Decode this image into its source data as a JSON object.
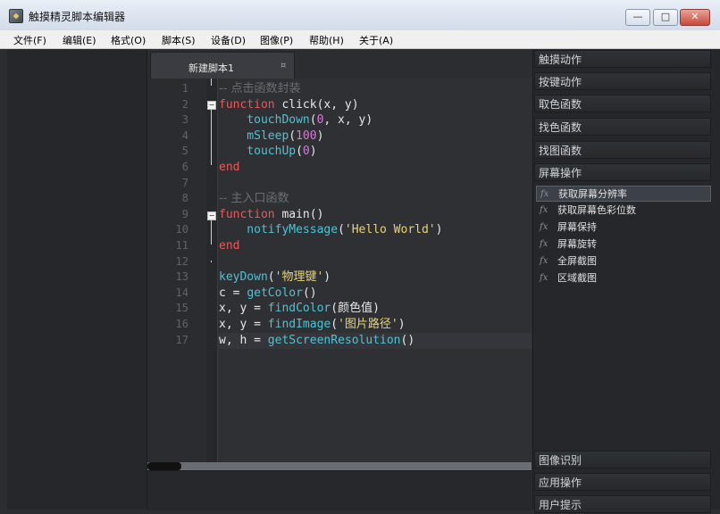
{
  "window": {
    "title": "触摸精灵脚本编辑器",
    "controls": {
      "minimize": "—",
      "maximize": "□",
      "close": "✕"
    }
  },
  "menu": [
    "文件(F)",
    "编辑(E)",
    "格式(O)",
    "脚本(S)",
    "设备(D)",
    "图像(P)",
    "帮助(H)",
    "关于(A)"
  ],
  "editor": {
    "tab": {
      "label": "新建脚本1",
      "close": "¤"
    },
    "line_numbers": [
      "1",
      "2",
      "3",
      "4",
      "5",
      "6",
      "7",
      "8",
      "9",
      "10",
      "11",
      "12",
      "13",
      "14",
      "15",
      "16",
      "17"
    ],
    "lines": [
      [
        {
          "t": "-- 点击函数封装",
          "c": "comment"
        }
      ],
      [
        {
          "t": "function",
          "c": "kw"
        },
        {
          "t": " click(x, y)",
          "c": "fn"
        }
      ],
      [
        {
          "t": "    touchDown",
          "c": "call"
        },
        {
          "t": "(",
          "c": "plain"
        },
        {
          "t": "0",
          "c": "num"
        },
        {
          "t": ", x, y)",
          "c": "plain"
        }
      ],
      [
        {
          "t": "    mSleep",
          "c": "call"
        },
        {
          "t": "(",
          "c": "plain"
        },
        {
          "t": "100",
          "c": "num"
        },
        {
          "t": ")",
          "c": "plain"
        }
      ],
      [
        {
          "t": "    touchUp",
          "c": "call"
        },
        {
          "t": "(",
          "c": "plain"
        },
        {
          "t": "0",
          "c": "num"
        },
        {
          "t": ")",
          "c": "plain"
        }
      ],
      [
        {
          "t": "end",
          "c": "kw"
        }
      ],
      [],
      [
        {
          "t": "-- 主入口函数",
          "c": "comment"
        }
      ],
      [
        {
          "t": "function",
          "c": "kw"
        },
        {
          "t": " main()",
          "c": "fn"
        }
      ],
      [
        {
          "t": "    notifyMessage",
          "c": "call"
        },
        {
          "t": "(",
          "c": "plain"
        },
        {
          "t": "'Hello World'",
          "c": "str"
        },
        {
          "t": ")",
          "c": "plain"
        }
      ],
      [
        {
          "t": "end",
          "c": "kw"
        }
      ],
      [],
      [
        {
          "t": "keyDown",
          "c": "call"
        },
        {
          "t": "(",
          "c": "plain"
        },
        {
          "t": "'物理键'",
          "c": "str"
        },
        {
          "t": ")",
          "c": "plain"
        }
      ],
      [
        {
          "t": "c = ",
          "c": "plain"
        },
        {
          "t": "getColor",
          "c": "call"
        },
        {
          "t": "()",
          "c": "plain"
        }
      ],
      [
        {
          "t": "x, y = ",
          "c": "plain"
        },
        {
          "t": "findColor",
          "c": "call"
        },
        {
          "t": "(颜色值)",
          "c": "plain"
        }
      ],
      [
        {
          "t": "x, y = ",
          "c": "plain"
        },
        {
          "t": "findImage",
          "c": "call"
        },
        {
          "t": "(",
          "c": "plain"
        },
        {
          "t": "'图片路径'",
          "c": "str"
        },
        {
          "t": ")",
          "c": "plain"
        }
      ],
      [
        {
          "t": "w, h = ",
          "c": "plain"
        },
        {
          "t": "getScreenResolution",
          "c": "call"
        },
        {
          "t": "()",
          "c": "plain"
        }
      ]
    ]
  },
  "function_panel": {
    "categories_top": [
      "触摸动作",
      "按键动作",
      "取色函数",
      "找色函数",
      "找图函数",
      "屏幕操作"
    ],
    "subitems": [
      "获取屏幕分辨率",
      "获取屏幕色彩位数",
      "屏幕保持",
      "屏幕旋转",
      "全屏截图",
      "区域截图"
    ],
    "selected_subitem_index": 0,
    "categories_bottom": [
      "图像识别",
      "应用操作",
      "用户提示"
    ],
    "fx_icon": "fx"
  },
  "colors": {
    "keyword": "#e55a5a",
    "call": "#4fc3d3",
    "number": "#d47ed4",
    "string": "#e7d47a",
    "comment": "#6a6e73",
    "background": "#2e3034"
  }
}
